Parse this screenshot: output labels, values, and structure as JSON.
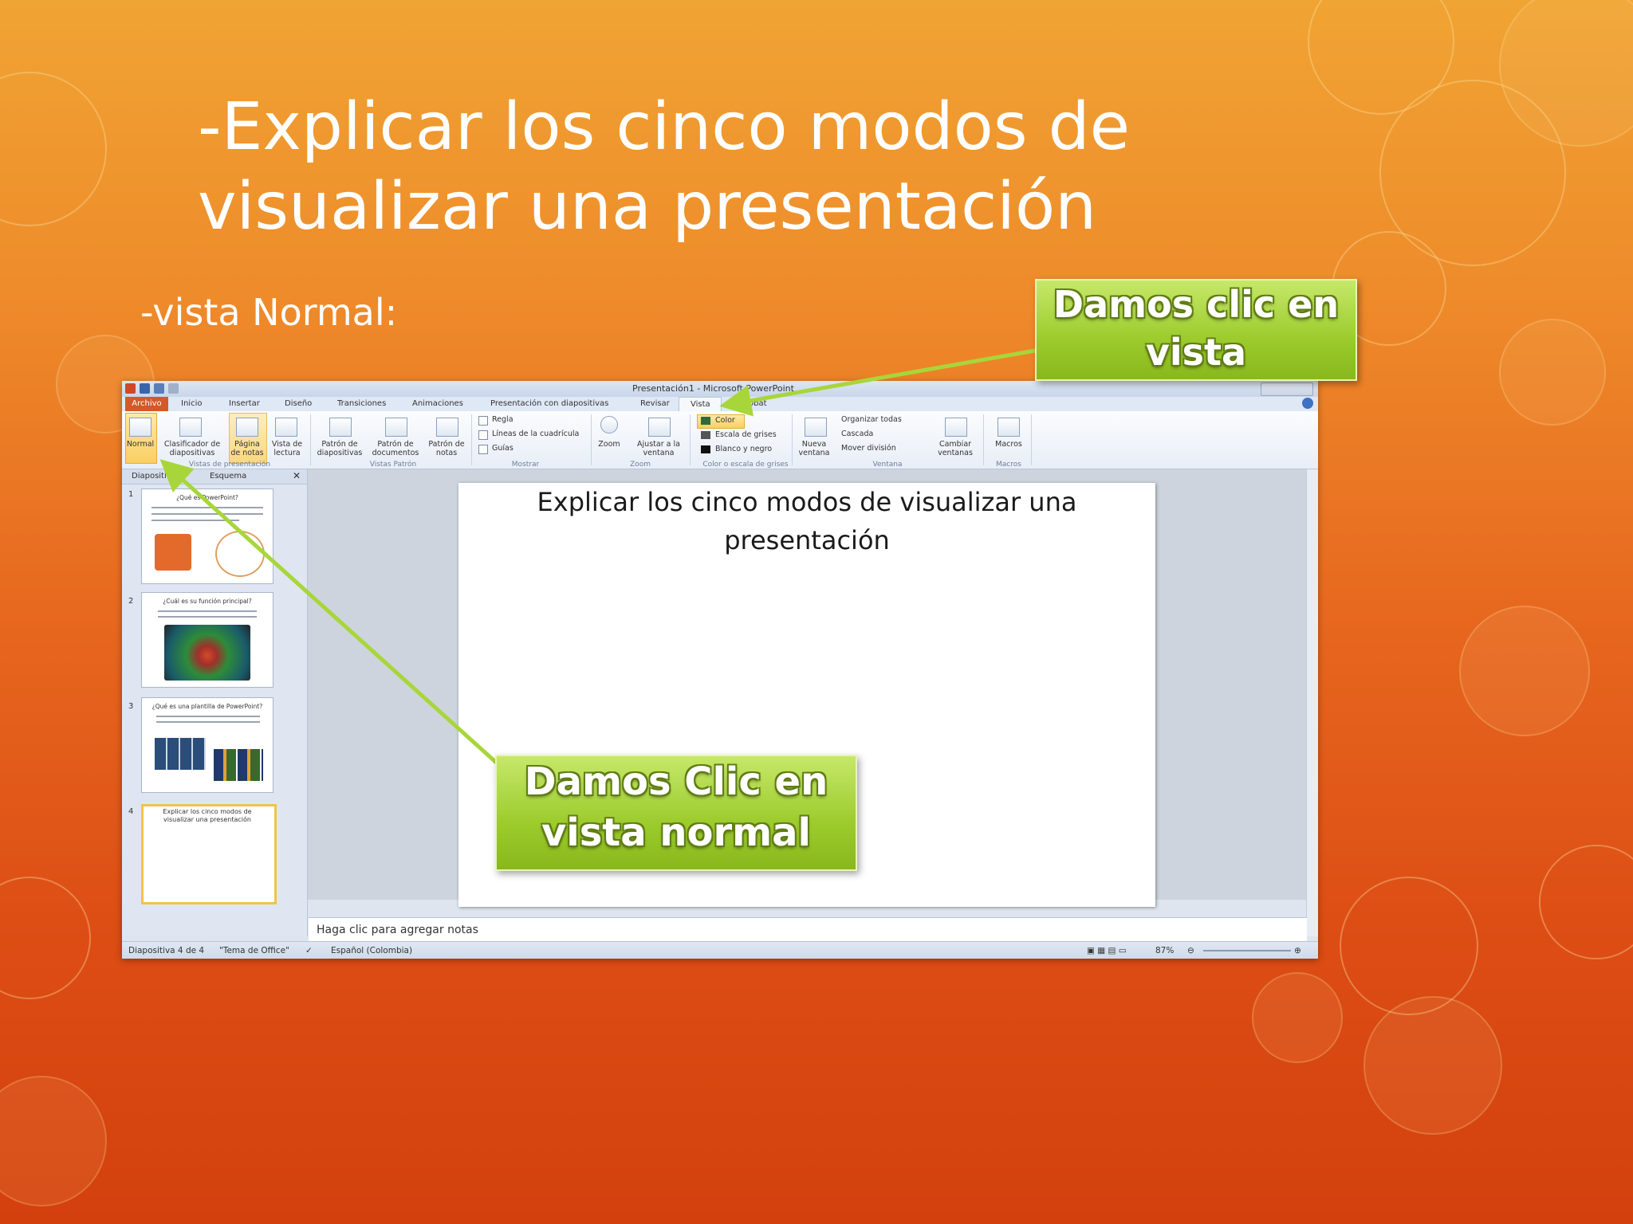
{
  "slide": {
    "title": "-Explicar los cinco modos de visualizar una presentación",
    "subtitle": "-vista Normal:"
  },
  "callouts": {
    "top": "Damos clic en vista",
    "bottom": "Damos Clic en vista normal"
  },
  "screenshot": {
    "window_title": "Presentación1 - Microsoft PowerPoint",
    "tabs": [
      "Archivo",
      "Inicio",
      "Insertar",
      "Diseño",
      "Transiciones",
      "Animaciones",
      "Presentación con diapositivas",
      "Revisar",
      "Vista",
      "Acrobat"
    ],
    "ribbon": {
      "normal": "Normal",
      "clasificador": "Clasificador de diapositivas",
      "pagina_notas": "Página de notas",
      "vista_lectura": "Vista de lectura",
      "group_vistas": "Vistas de presentación",
      "patron_diapositivas": "Patrón de diapositivas",
      "patron_documentos": "Patrón de documentos",
      "patron_notas": "Patrón de notas",
      "group_patron": "Vistas Patrón",
      "regla": "Regla",
      "lineas_cuadricula": "Líneas de la cuadrícula",
      "guias": "Guías",
      "group_mostrar": "Mostrar",
      "zoom": "Zoom",
      "ajustar_ventana": "Ajustar a la ventana",
      "group_zoom": "Zoom",
      "color": "Color",
      "escala_grises": "Escala de grises",
      "blanco_negro": "Blanco y negro",
      "group_color": "Color o escala de grises",
      "nueva_ventana": "Nueva ventana",
      "organizar_todas": "Organizar todas",
      "cascada": "Cascada",
      "mover_division": "Mover división",
      "cambiar_ventanas": "Cambiar ventanas",
      "group_ventana": "Ventana",
      "macros": "Macros",
      "group_macros": "Macros"
    },
    "pane_tabs": [
      "Diapositivas",
      "Esquema"
    ],
    "thumbnails": [
      {
        "num": "1",
        "title": "¿Qué es PowerPoint?"
      },
      {
        "num": "2",
        "title": "¿Cuál es su función principal?"
      },
      {
        "num": "3",
        "title": "¿Qué es una plantilla de PowerPoint?"
      },
      {
        "num": "4",
        "title": "Explicar los cinco modos de visualizar una presentación"
      }
    ],
    "current_slide_title": "Explicar los cinco modos de visualizar una presentación",
    "notes_placeholder": "Haga clic para agregar notas",
    "status": {
      "slide_count": "Diapositiva 4 de 4",
      "theme": "\"Tema de Office\"",
      "language": "Español (Colombia)",
      "zoom": "87%"
    }
  },
  "colors": {
    "callout_green": "#9ccb2c",
    "background_orange": "#e7681f",
    "archivo_tab": "#d35a28"
  }
}
